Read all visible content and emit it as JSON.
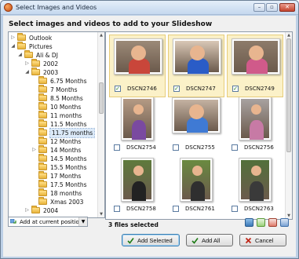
{
  "window": {
    "title": "Select Images and Videos"
  },
  "heading": "Select images and videos to add to your Slideshow",
  "tree": {
    "items": [
      {
        "label": "Outlook",
        "arrow": "▷",
        "level": 0,
        "expanded": false
      },
      {
        "label": "Pictures",
        "arrow": "◢",
        "level": 0,
        "expanded": true
      },
      {
        "label": "Ali & DJ",
        "arrow": "◢",
        "level": 1,
        "expanded": true
      },
      {
        "label": "2002",
        "arrow": "▷",
        "level": 2,
        "expanded": false
      },
      {
        "label": "2003",
        "arrow": "◢",
        "level": 2,
        "expanded": true
      },
      {
        "label": "6.75 Months",
        "arrow": "",
        "level": 3
      },
      {
        "label": "7 Months",
        "arrow": "",
        "level": 3
      },
      {
        "label": "8.5 Months",
        "arrow": "",
        "level": 3
      },
      {
        "label": "10 Months",
        "arrow": "",
        "level": 3
      },
      {
        "label": "11 months",
        "arrow": "",
        "level": 3
      },
      {
        "label": "11.5 Months",
        "arrow": "",
        "level": 3
      },
      {
        "label": "11.75 months",
        "arrow": "",
        "level": 3,
        "selected": true
      },
      {
        "label": "12 Months",
        "arrow": "",
        "level": 3
      },
      {
        "label": "14 Months",
        "arrow": "▷",
        "level": 3
      },
      {
        "label": "14.5 Months",
        "arrow": "",
        "level": 3
      },
      {
        "label": "15.5 Months",
        "arrow": "",
        "level": 3
      },
      {
        "label": "17 Months",
        "arrow": "",
        "level": 3
      },
      {
        "label": "17.5 Months",
        "arrow": "",
        "level": 3
      },
      {
        "label": "18 months",
        "arrow": "",
        "level": 3
      },
      {
        "label": "Xmas 2003",
        "arrow": "",
        "level": 3
      },
      {
        "label": "2004",
        "arrow": "▷",
        "level": 2
      }
    ]
  },
  "insert_position": {
    "value": "Add at current position"
  },
  "photos": [
    {
      "name": "DSCN2746",
      "checked": true,
      "orientation": "landscape",
      "bg": "#9c8a78",
      "shirt": "#c9463a"
    },
    {
      "name": "DSCN2747",
      "checked": true,
      "orientation": "landscape",
      "bg": "#d9c8b6",
      "shirt": "#2a5cc7"
    },
    {
      "name": "DSCN2749",
      "checked": true,
      "orientation": "landscape",
      "bg": "#8d7b6a",
      "shirt": "#d05a8a"
    },
    {
      "name": "DSCN2754",
      "checked": false,
      "orientation": "portrait",
      "bg": "#b49a84",
      "shirt": "#7a4aa0"
    },
    {
      "name": "DSCN2755",
      "checked": false,
      "orientation": "landscape",
      "bg": "#c4b2a2",
      "shirt": "#3f7ad4"
    },
    {
      "name": "DSCN2756",
      "checked": false,
      "orientation": "portrait",
      "bg": "#a8a2a0",
      "shirt": "#c77aa5"
    },
    {
      "name": "DSCN2758",
      "checked": false,
      "orientation": "portrait",
      "bg": "#5e7a3c",
      "shirt": "#222222"
    },
    {
      "name": "DSCN2761",
      "checked": false,
      "orientation": "portrait",
      "bg": "#6a8a40",
      "shirt": "#2f2f2f"
    },
    {
      "name": "DSCN2763",
      "checked": false,
      "orientation": "portrait",
      "bg": "#52703a",
      "shirt": "#3a3a3a"
    }
  ],
  "status": {
    "selected_count": "3 files selected"
  },
  "buttons": {
    "add_selected": "Add Selected",
    "add_all": "Add All",
    "cancel": "Cancel"
  },
  "colors": {
    "selection_bg": "#fbf1c8",
    "check_green": "#1d7a14",
    "title_bar": "#c5d8ee"
  }
}
